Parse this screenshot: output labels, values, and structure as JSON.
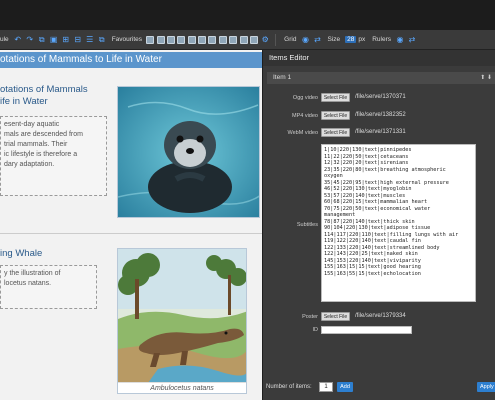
{
  "toolbar": {
    "left_label": "ule",
    "favourites_label": "Favourites",
    "grid_label": "Grid",
    "size_label": "Size",
    "size_value": "28",
    "size_unit": "px",
    "rulers_label": "Rulers"
  },
  "canvas": {
    "slide_header": "otations of Mammals to Life in Water",
    "section1_title": "otations of Mammals\nife in Water",
    "section1_text": "esent-day aquatic\nmals are descended from\ntrial mammals. Their\nic lifestyle is therefore a\ndary adaptation.",
    "section2_title": "ing Whale",
    "section2_text": "y the illustration of\nlocetus natans.",
    "image2_caption": "Ambulocetus natans"
  },
  "panel": {
    "title": "Items Editor",
    "item_label": "Item 1",
    "ogg_label": "Ogg video",
    "ogg_path": "/file/serve/1370371",
    "mp4_label": "MP4 video",
    "mp4_path": "/file/serve/1382352",
    "webm_label": "WebM video",
    "webm_path": "/file/serve/1371331",
    "select_file": "Select File",
    "subtitles_label": "Subtitles",
    "subtitles_text": "1|10|220|130|text|pinnipedes\n11|22|220|50|text|cetaceans\n12|32|220|20|text|sirenians\n23|35|220|80|text|breathing atmospheric\noxygen\n35|45|220|95|text|high external pressure\n46|52|220|130|text|myoglobin\n53|57|220|140|text|muscles\n60|68|220|15|text|mammalian heart\n70|75|220|50|text|economical water\nmanagement\n78|87|220|140|text|thick skin\n90|104|220|130|text|adipose tissue\n114|117|220|110|text|filling lungs with air\n119|122|220|140|text|caudal fin\n122|133|220|140|text|streamlined body\n122|143|220|25|text|naked skin\n145|153|220|140|text|viviparity\n155|163|15|15|text|good hearing\n155|163|55|15|text|echolocation",
    "poster_label": "Poster",
    "poster_path": "/file/serve/1379334",
    "id_label": "ID",
    "num_items_label": "Number of items:",
    "num_items_value": "1",
    "add_label": "Add",
    "apply_label": "Apply"
  },
  "colors": {
    "accent": "#2d7fd0",
    "header_blue": "#5b95cc",
    "panel_bg": "#3b3b3b"
  }
}
